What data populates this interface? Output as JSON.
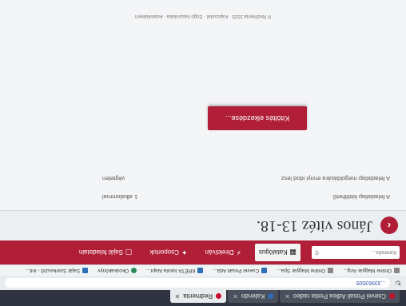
{
  "browser": {
    "tabs": [
      {
        "label": "Csevei Posali Adlea Posta radeo",
        "active": false
      },
      {
        "label": "Kalendo",
        "active": false
      },
      {
        "label": "Redmenta",
        "active": true
      }
    ],
    "url": "...33963505",
    "bookmarks": [
      {
        "label": "Online Magyar Ang...",
        "icon": "grey"
      },
      {
        "label": "Online Magyar Spa...",
        "icon": "grey"
      },
      {
        "label": "Csevei Posali Adá...",
        "icon": "blue"
      },
      {
        "label": "KRÉTA Iskola Alapr...",
        "icon": "blue"
      },
      {
        "label": "Okoskakönyv",
        "icon": "green"
      },
      {
        "label": "Saját Szerkesztő - init...",
        "icon": "blue"
      }
    ]
  },
  "appbar": {
    "search_placeholder": "Keresés...",
    "search_icon": "search-icon",
    "nav": [
      {
        "label": "Katalógus",
        "icon": "catalog-icon",
        "glyph": "▦",
        "active": true
      },
      {
        "label": "Direktíván",
        "icon": "lightning-icon",
        "glyph": "⚡",
        "active": false
      },
      {
        "label": "Csoportok",
        "icon": "users-icon",
        "glyph": "✦",
        "active": false
      },
      {
        "label": "Saját feladatain",
        "icon": "document-icon",
        "glyph": "▢",
        "active": false
      }
    ]
  },
  "page": {
    "title": "János vitéz 13-18.",
    "info": [
      {
        "label": "A feladatlap kitölthető",
        "value": "1 alkalommal"
      },
      {
        "label": "A feladatlap megoldására ennyi idod lesz",
        "value": "végtelen"
      }
    ],
    "start_label": "Kitöltés elkezdése...",
    "footer": "© Redmenta 2025 · Kapcsolat · Súgó használata · Adatvédelem"
  }
}
